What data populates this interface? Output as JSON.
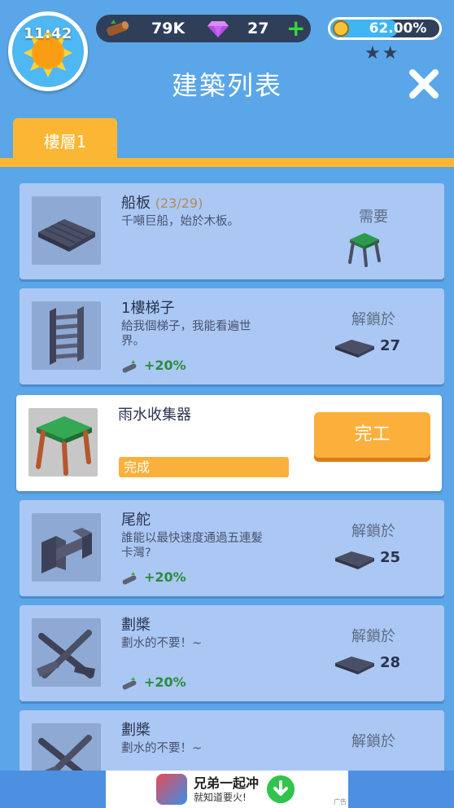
{
  "hud": {
    "time": "11:42",
    "wood": "79K",
    "gems": "27",
    "add": "+",
    "progress_label": "62.00%",
    "progress_value": 0.62,
    "stars": "★★",
    "accent_color": "#fbb733",
    "bar_color": "#2f3f5a"
  },
  "header": {
    "title": "建築列表"
  },
  "tabs": [
    {
      "label": "樓層1"
    }
  ],
  "items": [
    {
      "name": "船板",
      "count": "(23/29)",
      "desc": "千噸巨船，始於木板。",
      "status": "需要",
      "icon": "plank-pallet-icon"
    },
    {
      "name": "1樓梯子",
      "desc": "給我個梯子，我能看遍世界。",
      "bonus": "+20%",
      "status": "解鎖於",
      "cost": "27",
      "icon": "ladder-icon"
    },
    {
      "name": "雨水收集器",
      "button": "完工",
      "progress_label": "完成",
      "progress_value": 1.0,
      "icon": "rain-collector-icon"
    },
    {
      "name": "尾舵",
      "desc": "誰能以最快速度通過五連髮卡灣?",
      "bonus": "+20%",
      "status": "解鎖於",
      "cost": "25",
      "icon": "rudder-icon"
    },
    {
      "name": "劃槳",
      "desc": "劃水的不要！~",
      "bonus": "+20%",
      "status": "解鎖於",
      "cost": "28",
      "icon": "oars-icon"
    },
    {
      "name": "劃槳",
      "desc": "劃水的不要！~",
      "status": "解鎖於",
      "icon": "oars-icon"
    }
  ],
  "ad": {
    "title": "兄弟一起冲",
    "subtitle": "就知道要火!",
    "tag": "广告"
  }
}
